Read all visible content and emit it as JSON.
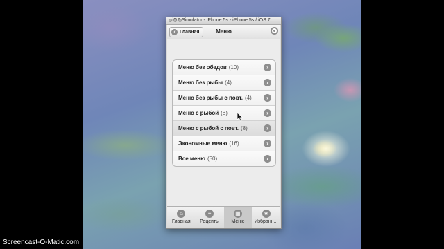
{
  "window": {
    "title": "iOS Simulator - iPhone 5s - iPhone 5s / iOS 7…"
  },
  "navbar": {
    "back_label": "Главная",
    "title": "Меню"
  },
  "menu_items": [
    {
      "label": "Меню без обедов",
      "count": "(10)"
    },
    {
      "label": "Меню без рыбы",
      "count": "(4)"
    },
    {
      "label": "Меню без рыбы с повт.",
      "count": "(4)"
    },
    {
      "label": "Меню с рыбой",
      "count": "(8)"
    },
    {
      "label": "Меню с рыбой с повт.",
      "count": "(8)"
    },
    {
      "label": "Экономные меню",
      "count": "(16)"
    },
    {
      "label": "Все меню",
      "count": "(50)"
    }
  ],
  "tabs": [
    {
      "label": "Главная",
      "icon": "home-icon"
    },
    {
      "label": "Рецепты",
      "icon": "list-icon"
    },
    {
      "label": "Меню",
      "icon": "grid-icon"
    },
    {
      "label": "Избранн...",
      "icon": "star-icon"
    }
  ],
  "caption": "Screencast-O-Matic.com",
  "colors": {
    "accent": "#8e8e8e",
    "background": "#000000"
  }
}
